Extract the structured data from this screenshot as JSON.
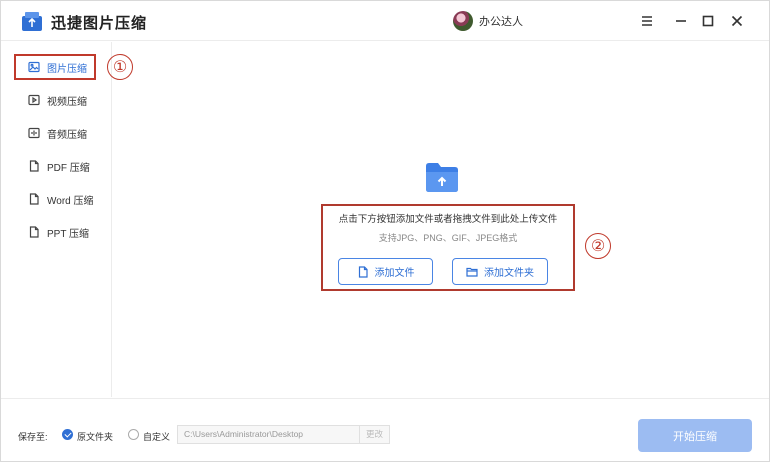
{
  "app": {
    "title": "迅捷图片压缩"
  },
  "user": {
    "name": "办公达人"
  },
  "sidebar": {
    "items": [
      {
        "label": "图片压缩",
        "icon": "image-icon",
        "active": true
      },
      {
        "label": "视频压缩",
        "icon": "video-icon",
        "active": false
      },
      {
        "label": "音频压缩",
        "icon": "audio-icon",
        "active": false
      },
      {
        "label": "PDF 压缩",
        "icon": "pdf-icon",
        "active": false
      },
      {
        "label": "Word 压缩",
        "icon": "word-icon",
        "active": false
      },
      {
        "label": "PPT 压缩",
        "icon": "ppt-icon",
        "active": false
      }
    ]
  },
  "annotations": {
    "marker1": "①",
    "marker2": "②"
  },
  "dropzone": {
    "text": "点击下方按钮添加文件或者拖拽文件到此处上传文件",
    "formats": "支持JPG、PNG、GIF、JPEG格式",
    "add_file": "添加文件",
    "add_folder": "添加文件夹"
  },
  "footer": {
    "save_label": "保存至:",
    "option_source": "原文件夹",
    "option_custom": "自定义",
    "path_value": "C:\\Users\\Administrator\\Desktop",
    "change_label": "更改",
    "start_label": "开始压缩"
  },
  "colors": {
    "accent": "#2f6fd4",
    "annotation": "#c0392b",
    "start_button": "#9cbcf2"
  }
}
